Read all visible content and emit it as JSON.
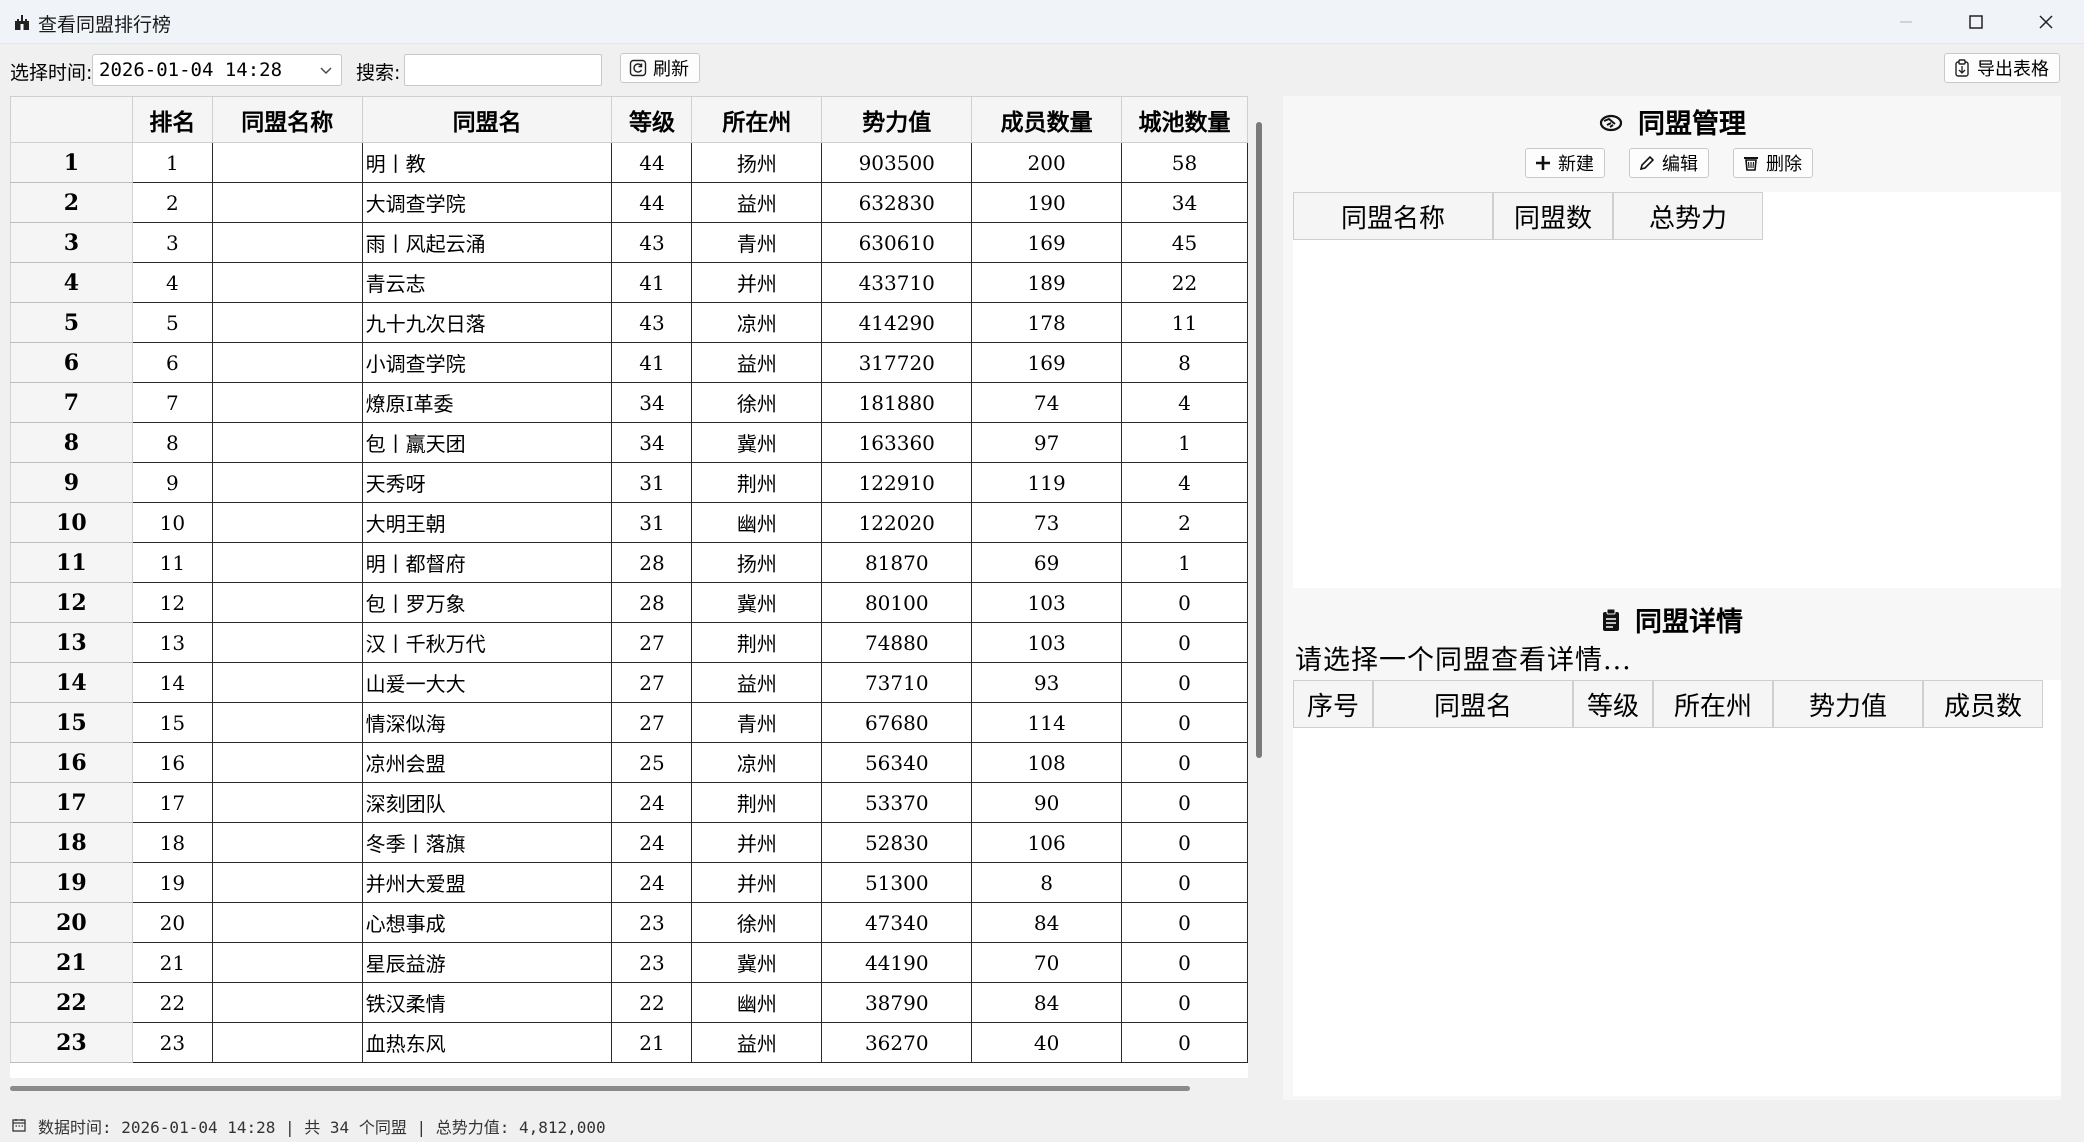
{
  "window": {
    "title": "查看同盟排行榜",
    "icon": "castle-icon"
  },
  "toolbar": {
    "time_label": "选择时间:",
    "time_value": "2026-01-04 14:28",
    "search_label": "搜索:",
    "search_value": "",
    "refresh_label": "刷新",
    "export_label": "导出表格"
  },
  "ranking_table": {
    "columns": [
      "排名",
      "同盟名称",
      "同盟名",
      "等级",
      "所在州",
      "势力值",
      "成员数量",
      "城池数量"
    ],
    "rows": [
      {
        "no": "1",
        "rank": "1",
        "group": "",
        "name": "明丨教",
        "level": "44",
        "state": "扬州",
        "power": "903500",
        "members": "200",
        "cities": "58"
      },
      {
        "no": "2",
        "rank": "2",
        "group": "",
        "name": "大调查学院",
        "level": "44",
        "state": "益州",
        "power": "632830",
        "members": "190",
        "cities": "34"
      },
      {
        "no": "3",
        "rank": "3",
        "group": "",
        "name": "雨丨风起云涌",
        "level": "43",
        "state": "青州",
        "power": "630610",
        "members": "169",
        "cities": "45"
      },
      {
        "no": "4",
        "rank": "4",
        "group": "",
        "name": "青云志",
        "level": "41",
        "state": "并州",
        "power": "433710",
        "members": "189",
        "cities": "22"
      },
      {
        "no": "5",
        "rank": "5",
        "group": "",
        "name": "九十九次日落",
        "level": "43",
        "state": "凉州",
        "power": "414290",
        "members": "178",
        "cities": "11"
      },
      {
        "no": "6",
        "rank": "6",
        "group": "",
        "name": "小调查学院",
        "level": "41",
        "state": "益州",
        "power": "317720",
        "members": "169",
        "cities": "8"
      },
      {
        "no": "7",
        "rank": "7",
        "group": "",
        "name": "燎原I革委",
        "level": "34",
        "state": "徐州",
        "power": "181880",
        "members": "74",
        "cities": "4"
      },
      {
        "no": "8",
        "rank": "8",
        "group": "",
        "name": "包丨羸天团",
        "level": "34",
        "state": "冀州",
        "power": "163360",
        "members": "97",
        "cities": "1"
      },
      {
        "no": "9",
        "rank": "9",
        "group": "",
        "name": "天秀呀",
        "level": "31",
        "state": "荆州",
        "power": "122910",
        "members": "119",
        "cities": "4"
      },
      {
        "no": "10",
        "rank": "10",
        "group": "",
        "name": "大明王朝",
        "level": "31",
        "state": "幽州",
        "power": "122020",
        "members": "73",
        "cities": "2"
      },
      {
        "no": "11",
        "rank": "11",
        "group": "",
        "name": "明丨都督府",
        "level": "28",
        "state": "扬州",
        "power": "81870",
        "members": "69",
        "cities": "1"
      },
      {
        "no": "12",
        "rank": "12",
        "group": "",
        "name": "包丨罗万象",
        "level": "28",
        "state": "冀州",
        "power": "80100",
        "members": "103",
        "cities": "0"
      },
      {
        "no": "13",
        "rank": "13",
        "group": "",
        "name": "汉丨千秋万代",
        "level": "27",
        "state": "荆州",
        "power": "74880",
        "members": "103",
        "cities": "0"
      },
      {
        "no": "14",
        "rank": "14",
        "group": "",
        "name": "山爰一大大",
        "level": "27",
        "state": "益州",
        "power": "73710",
        "members": "93",
        "cities": "0"
      },
      {
        "no": "15",
        "rank": "15",
        "group": "",
        "name": "情深似海",
        "level": "27",
        "state": "青州",
        "power": "67680",
        "members": "114",
        "cities": "0"
      },
      {
        "no": "16",
        "rank": "16",
        "group": "",
        "name": "凉州会盟",
        "level": "25",
        "state": "凉州",
        "power": "56340",
        "members": "108",
        "cities": "0"
      },
      {
        "no": "17",
        "rank": "17",
        "group": "",
        "name": "深刻团队",
        "level": "24",
        "state": "荆州",
        "power": "53370",
        "members": "90",
        "cities": "0"
      },
      {
        "no": "18",
        "rank": "18",
        "group": "",
        "name": "冬季丨落旗",
        "level": "24",
        "state": "并州",
        "power": "52830",
        "members": "106",
        "cities": "0"
      },
      {
        "no": "19",
        "rank": "19",
        "group": "",
        "name": "并州大爱盟",
        "level": "24",
        "state": "并州",
        "power": "51300",
        "members": "8",
        "cities": "0"
      },
      {
        "no": "20",
        "rank": "20",
        "group": "",
        "name": "心想事成",
        "level": "23",
        "state": "徐州",
        "power": "47340",
        "members": "84",
        "cities": "0"
      },
      {
        "no": "21",
        "rank": "21",
        "group": "",
        "name": "星辰益游",
        "level": "23",
        "state": "冀州",
        "power": "44190",
        "members": "70",
        "cities": "0"
      },
      {
        "no": "22",
        "rank": "22",
        "group": "",
        "name": "铁汉柔情",
        "level": "22",
        "state": "幽州",
        "power": "38790",
        "members": "84",
        "cities": "0"
      },
      {
        "no": "23",
        "rank": "23",
        "group": "",
        "name": "血热东风",
        "level": "21",
        "state": "益州",
        "power": "36270",
        "members": "40",
        "cities": "0"
      }
    ]
  },
  "alliance_mgmt": {
    "title": "同盟管理",
    "new_label": "新建",
    "edit_label": "编辑",
    "delete_label": "删除",
    "columns": [
      "同盟名称",
      "同盟数",
      "总势力"
    ]
  },
  "alliance_detail": {
    "title": "同盟详情",
    "hint": "请选择一个同盟查看详情...",
    "columns": [
      "序号",
      "同盟名",
      "等级",
      "所在州",
      "势力值",
      "成员数"
    ]
  },
  "status_bar": {
    "text": "数据时间: 2026-01-04 14:28 | 共 34 个同盟 | 总势力值: 4,812,000"
  }
}
